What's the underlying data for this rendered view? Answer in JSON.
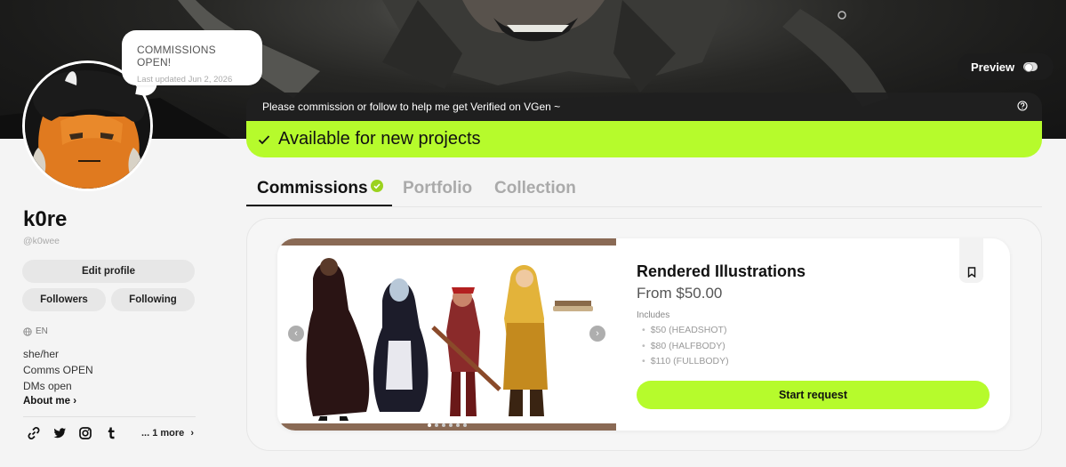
{
  "banner": {
    "preview_label": "Preview",
    "notice": "Please commission or follow to help me get Verified on VGen ~",
    "availability": "Available for new projects"
  },
  "status_bubble": {
    "title": "COMMISSIONS OPEN!",
    "updated": "Last updated Jun 2, 2026"
  },
  "profile": {
    "display_name": "k0re",
    "handle": "@k0wee",
    "edit_label": "Edit profile",
    "followers_label": "Followers",
    "following_label": "Following",
    "language": "EN",
    "bio_lines": [
      "she/her",
      "Comms OPEN",
      "DMs open"
    ],
    "about_label": "About me",
    "more_links": "... 1 more"
  },
  "social_icons": [
    "link-icon",
    "twitter-icon",
    "instagram-icon",
    "tumblr-icon"
  ],
  "tabs": [
    {
      "label": "Commissions",
      "active": true
    },
    {
      "label": "Portfolio",
      "active": false
    },
    {
      "label": "Collection",
      "active": false
    }
  ],
  "commission": {
    "title": "Rendered Illustrations",
    "price": "From $50.00",
    "includes_label": "Includes",
    "includes": [
      "$50 (HEADSHOT)",
      "$80 (HALFBODY)",
      "$110 (FULLBODY)"
    ],
    "cta": "Start request",
    "carousel_count": 6,
    "carousel_active": 1
  },
  "colors": {
    "accent": "#b6fb2c",
    "dark": "#202020",
    "badge": "#9bd21e"
  }
}
